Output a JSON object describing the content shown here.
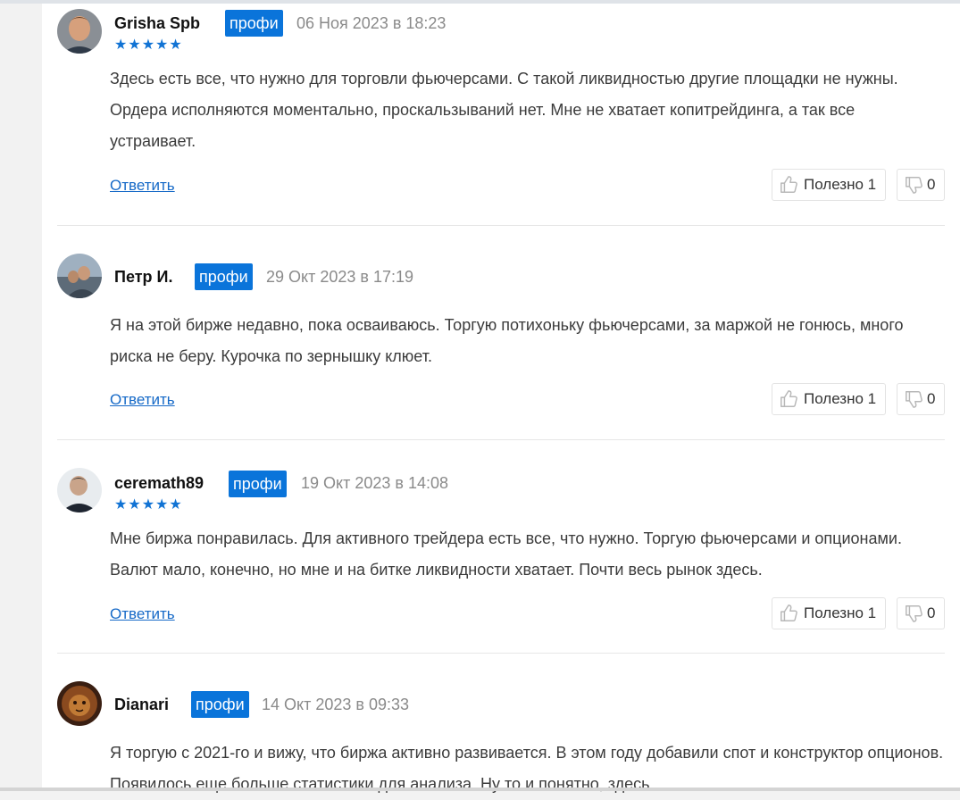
{
  "colors": {
    "accent": "#0a74da",
    "link": "#1569c7",
    "stars": "#1173d4"
  },
  "reviews": [
    {
      "author": "Grisha Spb",
      "badge": "профи",
      "date": "06 Ноя 2023 в 18:23",
      "stars": "★★★★★",
      "text": "Здесь есть все, что нужно для торговли фьючерсами. С такой ликвидностью другие площадки не нужны. Ордера исполняются моментально, проскальзываний нет. Мне не хватает копитрейдинга, а так все устраивает.",
      "reply": "Ответить",
      "useful_label": "Полезно",
      "useful_count": "1",
      "dislike_count": "0"
    },
    {
      "author": "Петр И.",
      "badge": "профи",
      "date": "29 Окт 2023 в 17:19",
      "stars": "",
      "text": "Я на этой бирже недавно, пока осваиваюсь. Торгую потихоньку фьючерсами, за маржой не гонюсь, много риска не беру. Курочка по зернышку клюет.",
      "reply": "Ответить",
      "useful_label": "Полезно",
      "useful_count": "1",
      "dislike_count": "0"
    },
    {
      "author": "ceremath89",
      "badge": "профи",
      "date": "19 Окт 2023 в 14:08",
      "stars": "★★★★★",
      "text": "Мне биржа понравилась. Для активного трейдера есть все, что нужно. Торгую фьючерсами и опционами. Валют мало, конечно, но мне и на битке ликвидности хватает. Почти весь рынок здесь.",
      "reply": "Ответить",
      "useful_label": "Полезно",
      "useful_count": "1",
      "dislike_count": "0"
    },
    {
      "author": "Dianari",
      "badge": "профи",
      "date": "14 Окт 2023 в 09:33",
      "stars": "",
      "text": "Я торгую с 2021-го и вижу, что биржа активно развивается. В этом году добавили спот и конструктор опционов. Появилось еще больше статистики для анализа. Ну то и понятно, здесь"
    }
  ]
}
